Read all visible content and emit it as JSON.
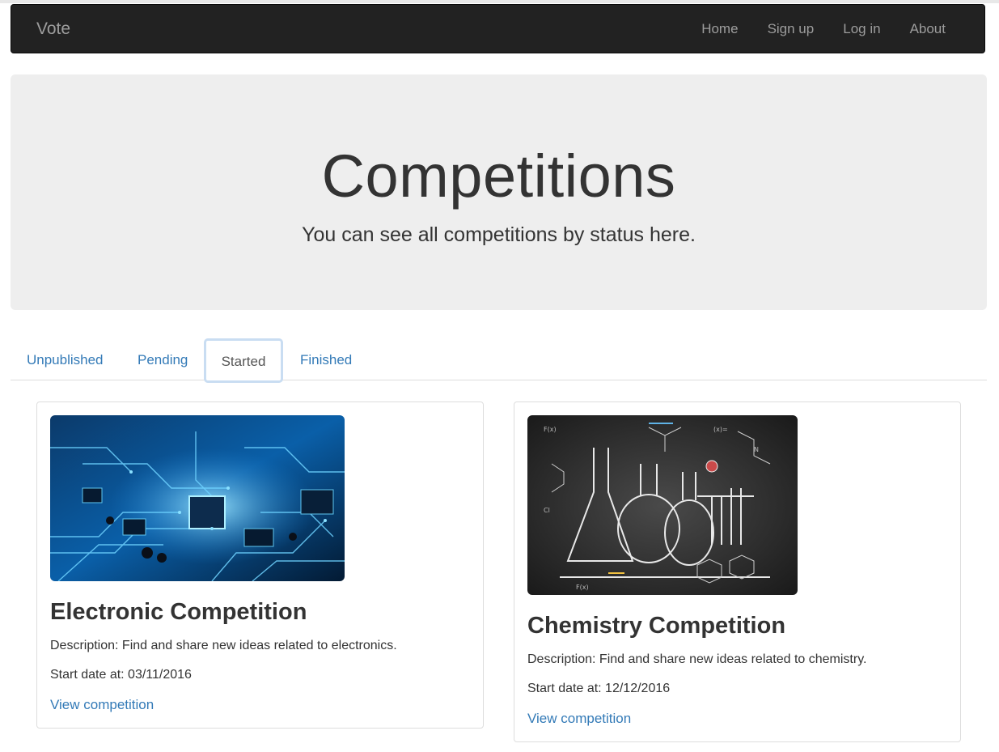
{
  "navbar": {
    "brand": "Vote",
    "links": [
      "Home",
      "Sign up",
      "Log in",
      "About"
    ]
  },
  "jumbotron": {
    "title": "Competitions",
    "subtitle": "You can see all competitions by status here."
  },
  "tabs": {
    "items": [
      "Unpublished",
      "Pending",
      "Started",
      "Finished"
    ],
    "active": "Started"
  },
  "competitions": [
    {
      "image": "circuit-board-image",
      "title": "Electronic Competition",
      "description": "Description: Find and share new ideas related to electronics.",
      "start_date": "Start date at: 03/11/2016",
      "link": "View competition"
    },
    {
      "image": "chemistry-chalkboard-image",
      "title": "Chemistry Competition",
      "description": "Description: Find and share new ideas related to chemistry.",
      "start_date": "Start date at: 12/12/2016",
      "link": "View competition"
    }
  ],
  "colors": {
    "navbar_bg": "#222222",
    "link": "#337ab7",
    "jumbotron_bg": "#eeeeee"
  }
}
